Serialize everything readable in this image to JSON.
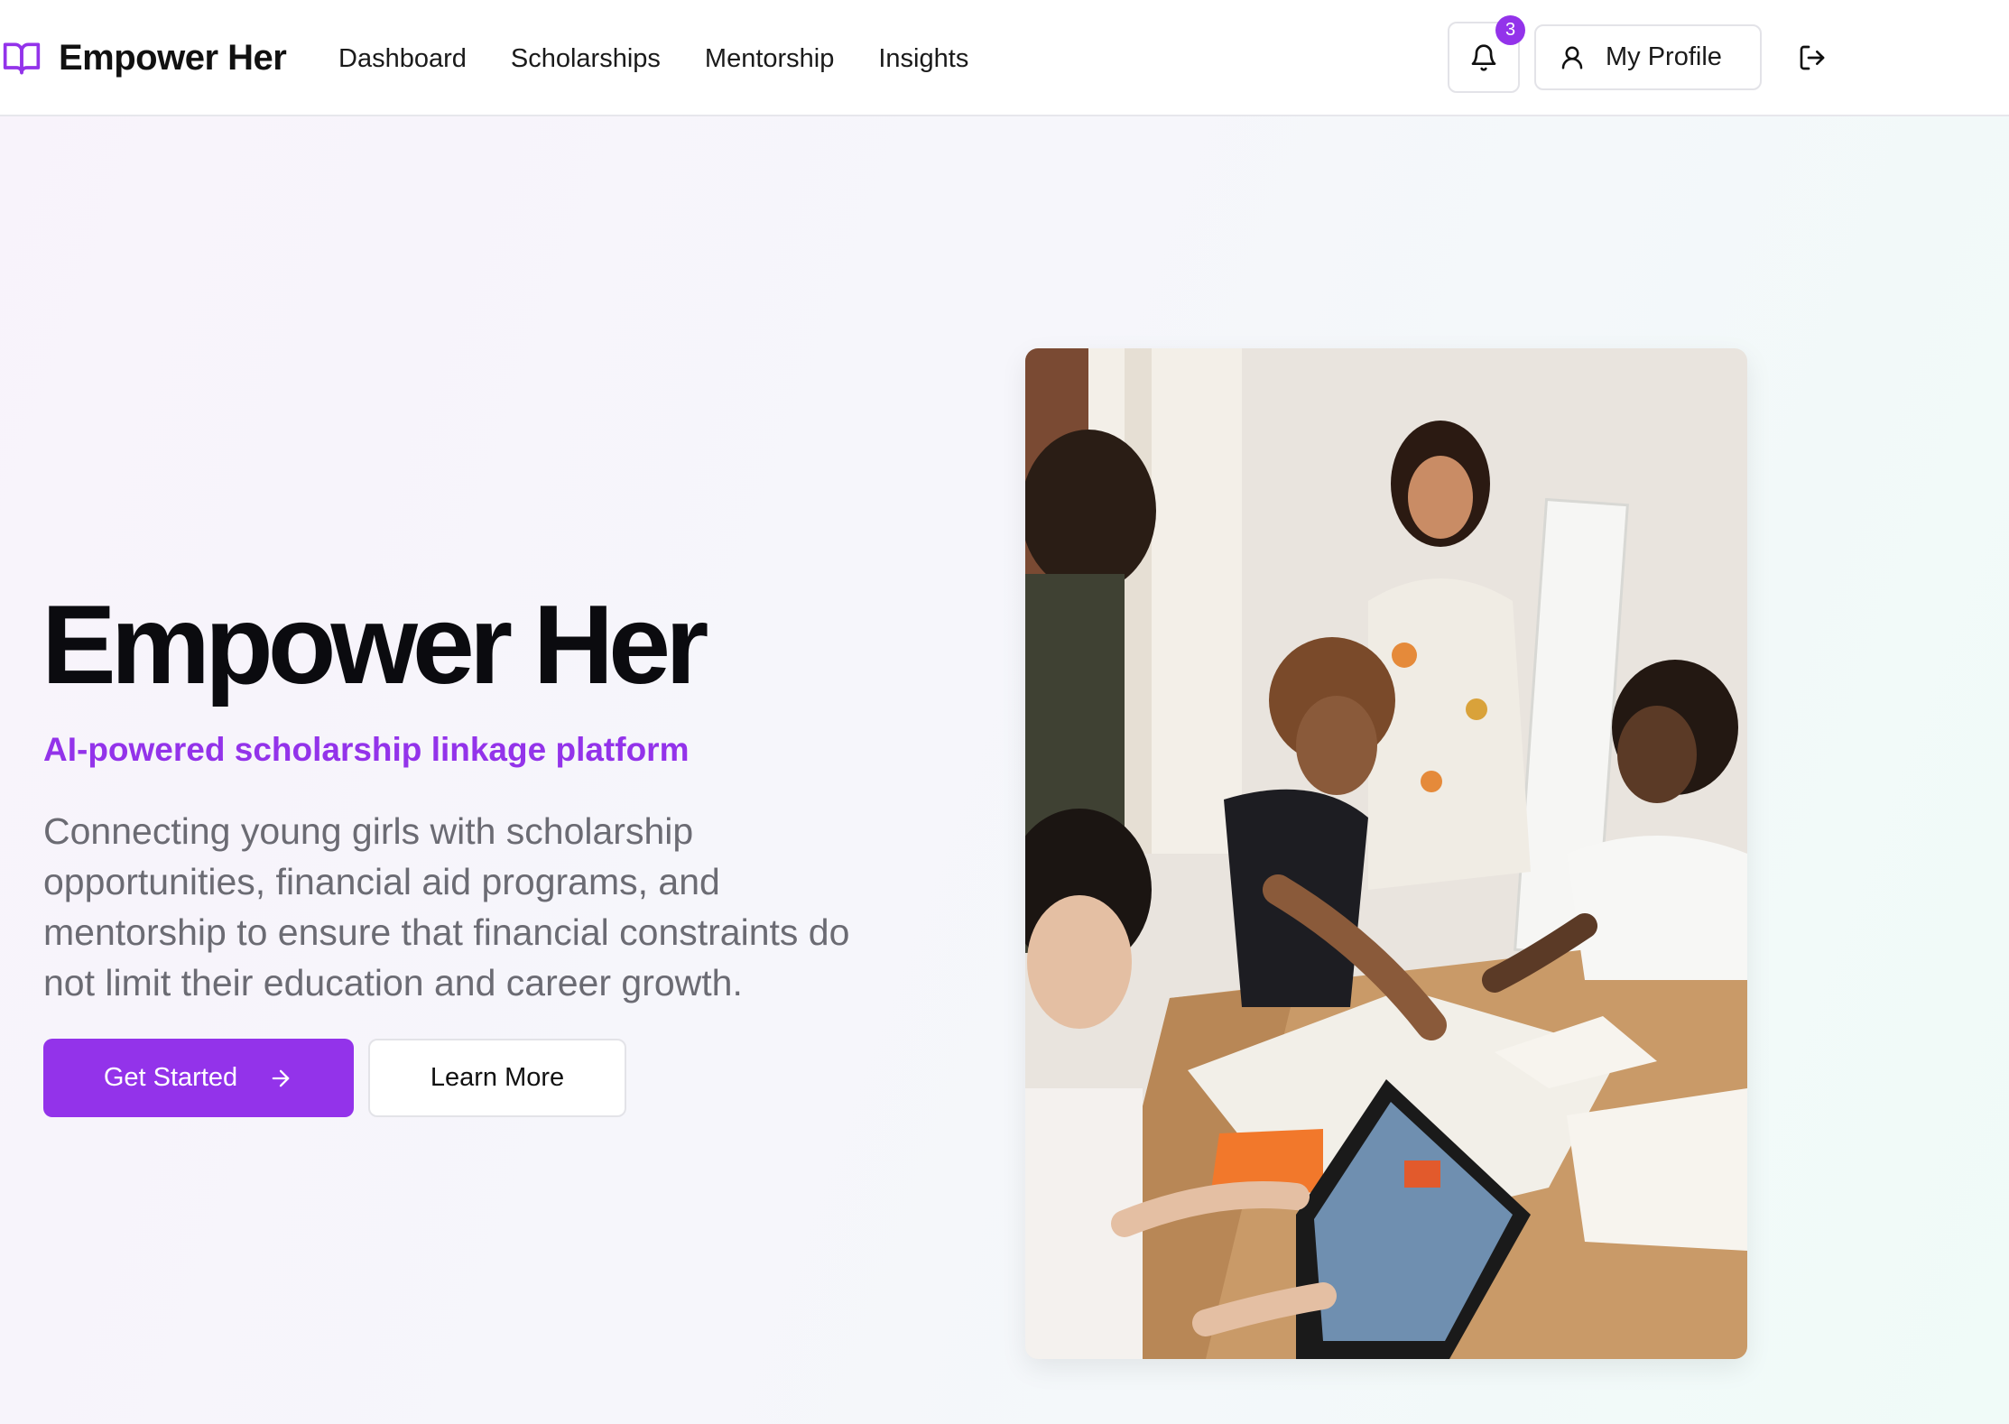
{
  "header": {
    "brand": "Empower Her",
    "nav": [
      {
        "label": "Dashboard"
      },
      {
        "label": "Scholarships"
      },
      {
        "label": "Mentorship"
      },
      {
        "label": "Insights"
      }
    ],
    "notifications_count": "3",
    "profile_label": "My Profile",
    "icons": {
      "brand": "open-book-icon",
      "notifications": "bell-icon",
      "profile": "user-icon",
      "logout": "log-out-icon"
    }
  },
  "hero": {
    "title": "Empower Her",
    "subtitle": "AI-powered scholarship linkage platform",
    "description": "Connecting young girls with scholarship opportunities, financial aid programs, and mentorship to ensure that financial constraints do not limit their education and career growth.",
    "primary_button": "Get Started",
    "secondary_button": "Learn More",
    "primary_icon": "arrow-right-icon",
    "image": "photo of young women collaborating around a table with papers and a tablet"
  },
  "colors": {
    "accent": "#9333ea",
    "text": "#111111",
    "muted_text": "#6b6b73",
    "border": "#e3e3e8"
  }
}
